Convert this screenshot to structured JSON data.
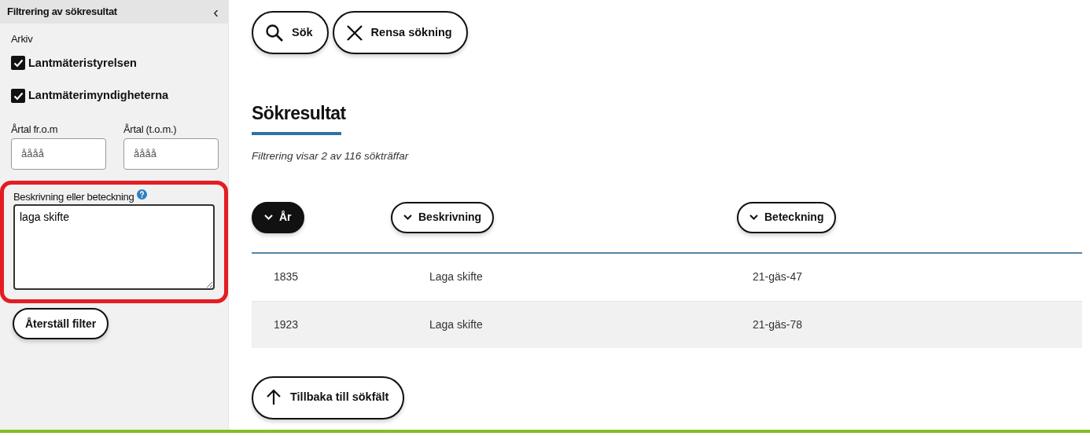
{
  "sidebar": {
    "title": "Filtrering av sökresultat",
    "collapse_icon": "‹",
    "archive_label": "Arkiv",
    "archives": [
      {
        "label": "Lantmäteristyrelsen",
        "checked": true
      },
      {
        "label": "Lantmäterimyndigheterna",
        "checked": true
      }
    ],
    "year_fields": [
      {
        "label": "Årtal fr.o.m",
        "placeholder": "åååå"
      },
      {
        "label": "Årtal (t.o.m.)",
        "placeholder": "åååå"
      }
    ],
    "description_field": {
      "label": "Beskrivning eller beteckning",
      "value": "laga skifte",
      "highlighted": true
    },
    "reset_button": "Återställ filter"
  },
  "toolbar": [
    {
      "kind": "search",
      "label": "Sök"
    },
    {
      "kind": "clear",
      "label": "Rensa sökning"
    }
  ],
  "results": {
    "heading": "Sökresultat",
    "summary": "Filtrering visar 2 av 116 sökträffar",
    "sort_buttons": [
      {
        "label": "År",
        "selected": true
      },
      {
        "label": "Beskrivning",
        "selected": false
      },
      {
        "label": "Beteckning",
        "selected": false
      }
    ],
    "rows": [
      [
        "1835",
        "Laga skifte",
        "21-gäs-47"
      ],
      [
        "1923",
        "Laga skifte",
        "21-gäs-78"
      ]
    ]
  },
  "back_button": "Tillbaka till sökfält"
}
